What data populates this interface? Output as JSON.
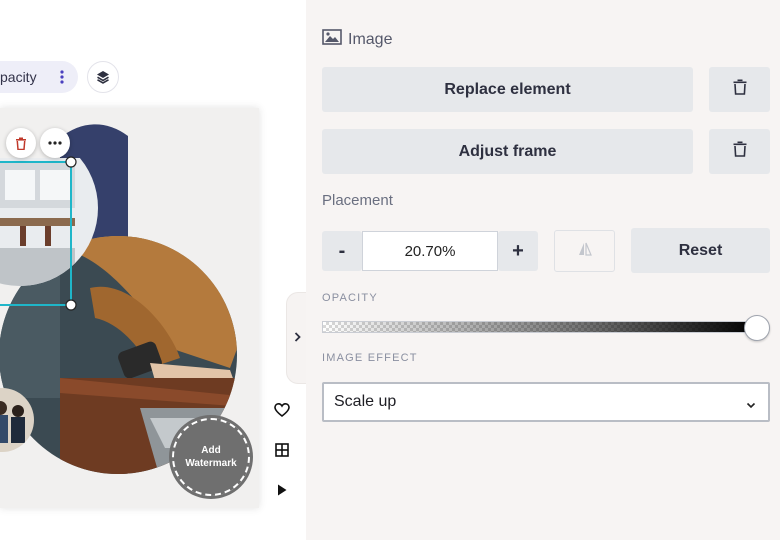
{
  "toolbar": {
    "opacity_label": "pacity",
    "more_icon": "vertical-dots-icon",
    "layers_icon": "layers-icon"
  },
  "canvas": {
    "watermark_line1": "Add",
    "watermark_line2": "Watermark",
    "floating_actions": [
      "delete-icon",
      "more-icon"
    ],
    "side_actions": [
      "heart-icon",
      "grid-icon",
      "play-icon"
    ],
    "collapse_icon": "chevron-right-icon"
  },
  "panel": {
    "title": "Image",
    "title_icon": "image-icon",
    "replace_label": "Replace element",
    "adjust_label": "Adjust frame",
    "placement_label": "Placement",
    "zoom_minus": "-",
    "zoom_value": "20.70%",
    "zoom_plus": "+",
    "reset_label": "Reset",
    "opacity_label": "OPACITY",
    "opacity_value": 1.0,
    "effect_label": "IMAGE EFFECT",
    "effect_value": "Scale up"
  },
  "colors": {
    "panel_bg": "#f7f4f3",
    "button_grey": "#e6e8eb",
    "selection": "#1fb6c9",
    "navy": "#35406b",
    "delete_red": "#c0392b"
  }
}
